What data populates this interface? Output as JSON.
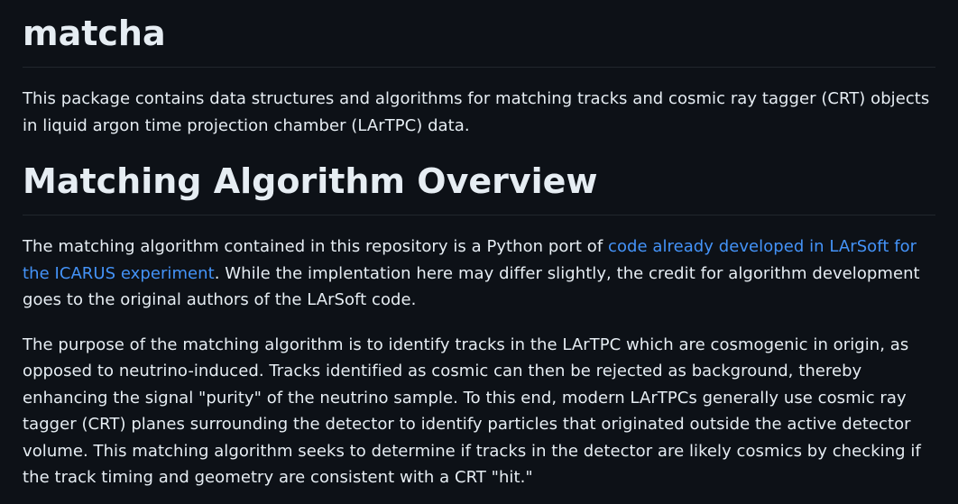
{
  "title": "matcha",
  "intro": "This package contains data structures and algorithms for matching tracks and cosmic ray tagger (CRT) objects in liquid argon time projection chamber (LArTPC) data.",
  "section_heading": "Matching Algorithm Overview",
  "paragraph1": {
    "before_link": "The matching algorithm contained in this repository is a Python port of ",
    "link_text": "code already developed in LArSoft for the ICARUS experiment",
    "after_link": ". While the implentation here may differ slightly, the credit for algorithm development goes to the original authors of the LArSoft code."
  },
  "paragraph2": "The purpose of the matching algorithm is to identify tracks in the LArTPC which are cosmogenic in origin, as opposed to neutrino-induced. Tracks identified as cosmic can then be rejected as background, thereby enhancing the signal \"purity\" of the neutrino sample. To this end, modern LArTPCs generally use cosmic ray tagger (CRT) planes surrounding the detector to identify particles that originated outside the active detector volume. This matching algorithm seeks to determine if tracks in the detector are likely cosmics by checking if the track timing and geometry are consistent with a CRT \"hit.\"",
  "colors": {
    "background": "#0d1117",
    "text": "#e6edf3",
    "link": "#4493f8",
    "divider": "#21262d"
  }
}
